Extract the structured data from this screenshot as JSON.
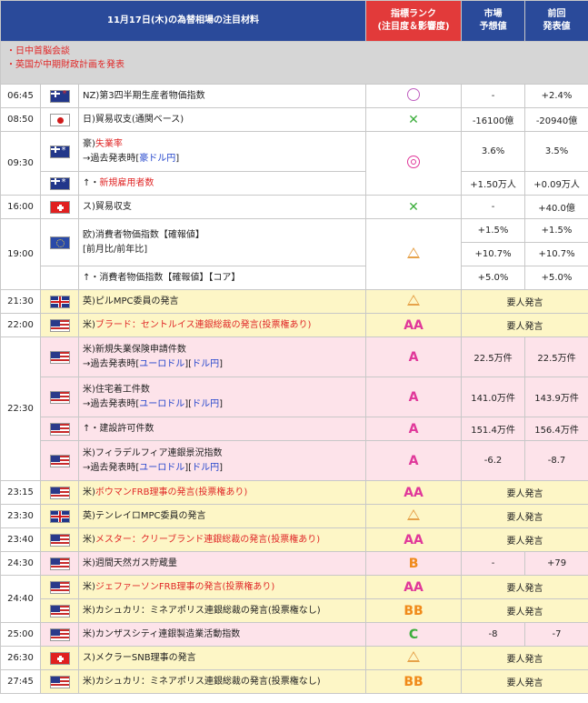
{
  "header": {
    "title": "11月17日(木)の為替相場の注目材料",
    "rank_line1": "指標ランク",
    "rank_line2": "(注目度＆影響度)",
    "market_line1": "市場",
    "market_line2": "予想値",
    "prev_line1": "前回",
    "prev_line2": "発表値"
  },
  "summary": [
    "・日中首脳会談",
    "・英国が中期財政計画を発表"
  ],
  "rows": {
    "r0645": {
      "time": "06:45",
      "flag": "nz-flag-icon",
      "ev1": "NZ)第3四半期生産者物価指数",
      "fc": "-",
      "pr": "+2.4%"
    },
    "r0850": {
      "time": "08:50",
      "flag": "japan-flag-icon",
      "ev1": "日)貿易収支(通関ベース)",
      "fc": "-16100億",
      "pr": "-20940億"
    },
    "r0930a": {
      "time": "09:30",
      "ev_prefix": "豪)",
      "ev_red": "失業率",
      "ev2_prefix": "→過去発表時[",
      "ev2_link": "豪ドル円",
      "ev2_suffix": "]",
      "fc": "3.6%",
      "pr": "3.5%"
    },
    "r0930b": {
      "ev_prefix": "↑・",
      "ev_red": "新規雇用者数",
      "fc": "+1.50万人",
      "pr": "+0.09万人"
    },
    "r1600": {
      "time": "16:00",
      "ev1": "ス)貿易収支",
      "fc": "-",
      "pr": "+40.0億"
    },
    "r1900a": {
      "time": "19:00",
      "ev1": "欧)消費者物価指数【確報値】",
      "ev2": "[前月比/前年比]",
      "fc1": "+1.5%",
      "pr1": "+1.5%",
      "fc2": "+10.7%",
      "pr2": "+10.7%"
    },
    "r1900b": {
      "ev1": "↑・消費者物価指数【確報値】【コア】",
      "fc": "+5.0%",
      "pr": "+5.0%"
    },
    "r2130": {
      "time": "21:30",
      "ev1": "英)ピルMPC委員の発言",
      "note": "要人発言"
    },
    "r2200": {
      "time": "22:00",
      "ev_prefix": "米)",
      "ev_red": "ブラード：セントルイス連銀総裁の発言(投票権あり)",
      "rank": "AA",
      "note": "要人発言"
    },
    "r2230a": {
      "time": "22:30",
      "ev1": "米)新規失業保険申請件数",
      "ev2_prefix": "→過去発表時[",
      "ev2_link1": "ユーロドル",
      "ev2_link2": "ドル円",
      "ev2_suffix": "]",
      "rank": "A",
      "fc": "22.5万件",
      "pr": "22.5万件"
    },
    "r2230b": {
      "ev1": "米)住宅着工件数",
      "ev2_prefix": "→過去発表時[",
      "ev2_link1": "ユーロドル",
      "ev2_link2": "ドル円",
      "ev2_suffix": "]",
      "rank": "A",
      "fc": "141.0万件",
      "pr": "143.9万件"
    },
    "r2230c": {
      "ev1": "↑・建設許可件数",
      "rank": "A",
      "fc": "151.4万件",
      "pr": "156.4万件"
    },
    "r2230d": {
      "ev1": "米)フィラデルフィア連銀景況指数",
      "ev2_prefix": "→過去発表時[",
      "ev2_link1": "ユーロドル",
      "ev2_link2": "ドル円",
      "ev2_suffix": "]",
      "rank": "A",
      "fc": "-6.2",
      "pr": "-8.7"
    },
    "r2315": {
      "time": "23:15",
      "ev_prefix": "米)",
      "ev_red": "ボウマンFRB理事の発言(投票権あり)",
      "rank": "AA",
      "note": "要人発言"
    },
    "r2330": {
      "time": "23:30",
      "ev1": "英)テンレイロMPC委員の発言",
      "note": "要人発言"
    },
    "r2340": {
      "time": "23:40",
      "ev_prefix": "米)",
      "ev_red": "メスター：クリーブランド連銀総裁の発言(投票権あり)",
      "rank": "AA",
      "note": "要人発言"
    },
    "r2430": {
      "time": "24:30",
      "ev1": "米)週間天然ガス貯蔵量",
      "rank": "B",
      "fc": "-",
      "pr": "+79"
    },
    "r2440a": {
      "time": "24:40",
      "ev_prefix": "米)",
      "ev_red": "ジェファーソンFRB理事の発言(投票権あり)",
      "rank": "AA",
      "note": "要人発言"
    },
    "r2440b": {
      "ev1": "米)カシュカリ：ミネアポリス連銀総裁の発言(投票権なし)",
      "rank": "BB",
      "note": "要人発言"
    },
    "r2500": {
      "time": "25:00",
      "ev1": "米)カンザスシティ連銀製造業活動指数",
      "rank": "C",
      "fc": "-8",
      "pr": "-7"
    },
    "r2630": {
      "time": "26:30",
      "ev1": "ス)メクラーSNB理事の発言",
      "note": "要人発言"
    },
    "r2745": {
      "time": "27:45",
      "ev1": "米)カシュカリ：ミネアポリス連銀総裁の発言(投票権なし)",
      "rank": "BB",
      "note": "要人発言"
    }
  },
  "colors": {
    "header_blue": "#2a4a9a",
    "header_red": "#e23a3a",
    "summary_gray": "#d6d6d6",
    "yellow_row": "#fdf6c6",
    "pink_row": "#fde3ea",
    "red_text": "#e02828",
    "link_blue": "#2244cc",
    "rank_magenta": "#e0389a",
    "rank_orange": "#f08a1a",
    "rank_green": "#3cae3c"
  }
}
